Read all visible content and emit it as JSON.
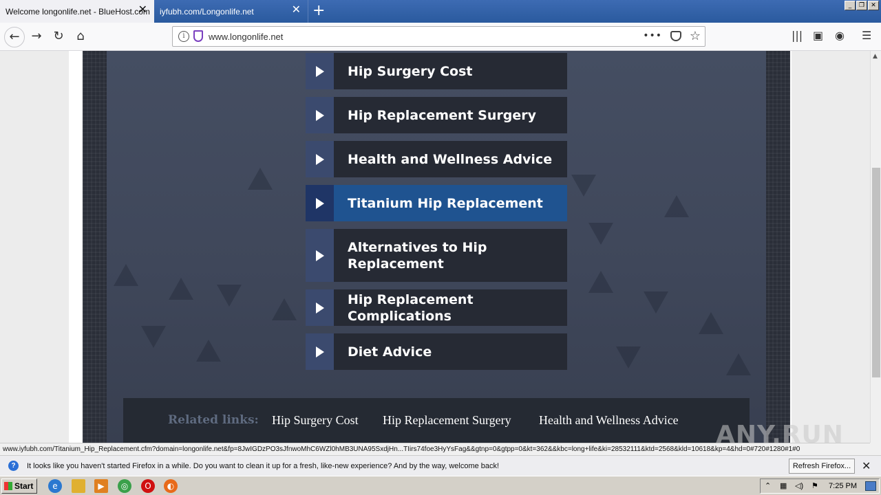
{
  "browser": {
    "tabs": [
      {
        "title": "Welcome longonlife.net - BlueHost.com",
        "active": true
      },
      {
        "title": "iyfubh.com/Longonlife.net",
        "active": false
      }
    ],
    "url": "www.longonlife.net",
    "status_url": "www.iyfubh.com/Titanium_Hip_Replacement.cfm?domain=longonlife.net&fp=8JwIGDzPO3sJfnwoMhC6WZl0hMB3UNA95SxdjHn...TIirs74foe3HyYsFag&&gtnp=0&gtpp=0&kt=362&&kbc=long+life&ki=28532111&ktd=2568&kld=10618&kp=4&hd=0#720#1280#1#0"
  },
  "menu": {
    "items": [
      {
        "label": "Hip Surgery Cost",
        "active": false
      },
      {
        "label": "Hip Replacement Surgery",
        "active": false
      },
      {
        "label": "Health and Wellness Advice",
        "active": false
      },
      {
        "label": "Titanium Hip Replacement",
        "active": true
      },
      {
        "label": "Alternatives to Hip Replacement",
        "active": false
      },
      {
        "label": "Hip Replacement Complications",
        "active": false
      },
      {
        "label": "Diet Advice",
        "active": false
      }
    ]
  },
  "related": {
    "label": "Related links:",
    "links": [
      "Hip Surgery Cost",
      "Hip Replacement Surgery",
      "Health and Wellness Advice"
    ]
  },
  "notification": {
    "message": "It looks like you haven't started Firefox in a while. Do you want to clean it up for a fresh, like-new experience? And by the way, welcome back!",
    "button": "Refresh Firefox..."
  },
  "taskbar": {
    "start_label": "Start",
    "clock": "7:25 PM"
  },
  "watermark": "ANY.RUN",
  "colors": {
    "active_item": "#1f5390",
    "item_bg": "#262a34",
    "arrow_bg": "#3b4a6e"
  }
}
